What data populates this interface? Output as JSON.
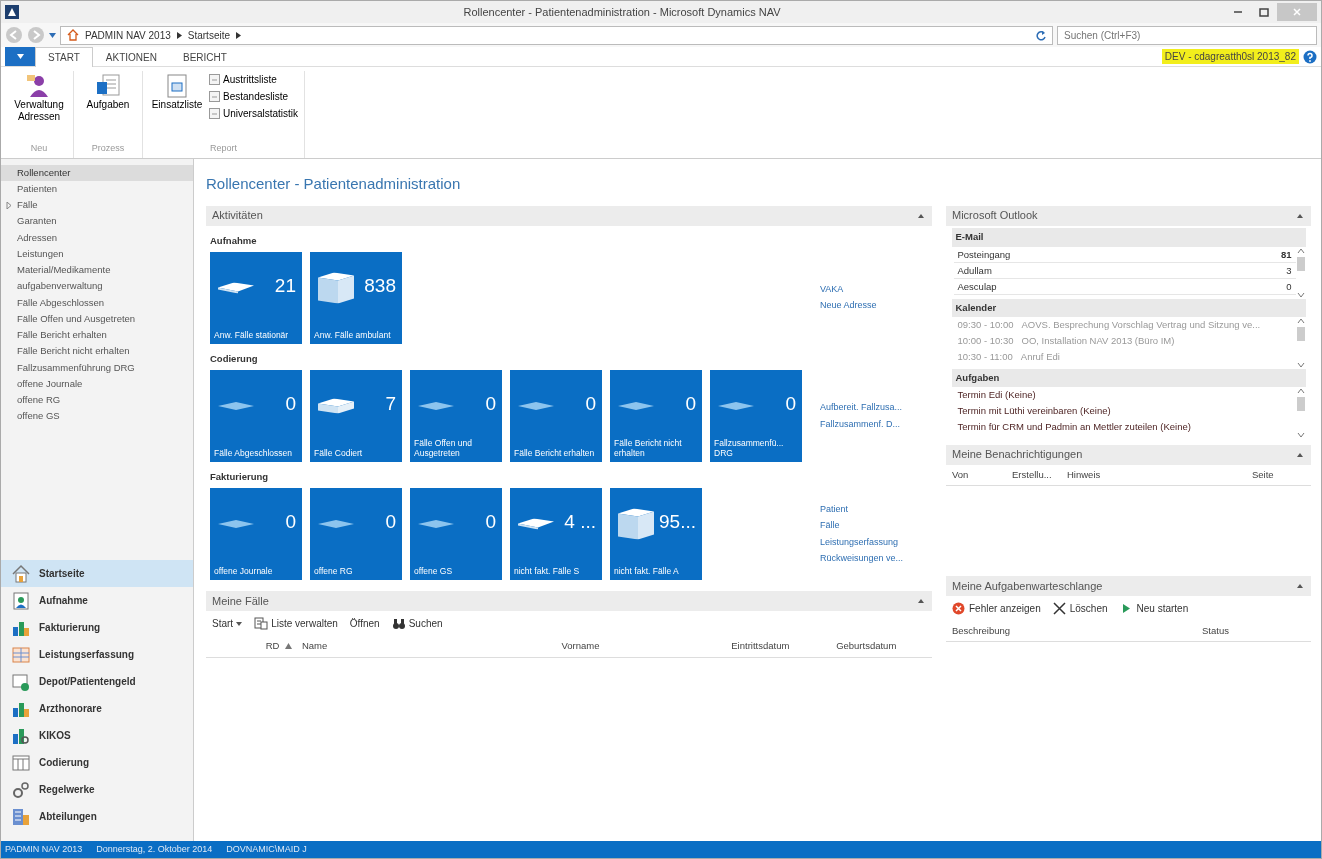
{
  "window": {
    "title": "Rollencenter - Patientenadministration - Microsoft Dynamics NAV"
  },
  "address_bar": {
    "breadcrumb": [
      "PADMIN NAV 2013",
      "Startseite"
    ],
    "search": {
      "placeholder": "Suchen (Ctrl+F3)"
    }
  },
  "ribbon": {
    "tabs": [
      {
        "label": "START",
        "selected": true
      },
      {
        "label": "AKTIONEN",
        "selected": false
      },
      {
        "label": "BERICHT",
        "selected": false
      }
    ],
    "company": "DEV - cdagreatth0sl 2013_82",
    "groups": [
      {
        "label": "Neu",
        "large": [
          {
            "label": "Verwaltung Adressen",
            "kind": "people"
          }
        ]
      },
      {
        "label": "Prozess",
        "large": [
          {
            "label": "Aufgaben",
            "kind": "tasks"
          }
        ]
      },
      {
        "label": "Report",
        "large": [
          {
            "label": "Einsatzliste",
            "kind": "report"
          }
        ],
        "small": [
          "Austrittsliste",
          "Bestandesliste",
          "Universalstatistik"
        ]
      }
    ]
  },
  "navigation": {
    "items": [
      {
        "label": "Rollencenter",
        "selected": true
      },
      {
        "label": "Patienten",
        "selected": false
      },
      {
        "label": "Fälle",
        "selected": false,
        "expanded": false
      },
      {
        "label": "Garanten",
        "selected": false
      },
      {
        "label": "Adressen",
        "selected": false
      },
      {
        "label": "Leistungen",
        "selected": false
      },
      {
        "label": "Material/Medikamente",
        "selected": false
      },
      {
        "label": "aufgabenverwaltung",
        "selected": false
      },
      {
        "label": "Fälle Abgeschlossen",
        "selected": false
      },
      {
        "label": "Fälle Offen und Ausgetreten",
        "selected": false
      },
      {
        "label": "Fälle Bericht erhalten",
        "selected": false
      },
      {
        "label": "Fälle Bericht nicht erhalten",
        "selected": false
      },
      {
        "label": "Fallzusammenführung DRG",
        "selected": false
      },
      {
        "label": "offene Journale",
        "selected": false
      },
      {
        "label": "offene RG",
        "selected": false
      },
      {
        "label": "offene GS",
        "selected": false
      }
    ],
    "departments": [
      {
        "label": "Startseite",
        "kind": "home",
        "selected": true
      },
      {
        "label": "Aufnahme",
        "kind": "intake",
        "selected": false
      },
      {
        "label": "Fakturierung",
        "kind": "chart",
        "selected": false
      },
      {
        "label": "Leistungserfassung",
        "kind": "table",
        "selected": false
      },
      {
        "label": "Depot/Patientengeld",
        "kind": "deposit",
        "selected": false
      },
      {
        "label": "Arzthonorare",
        "kind": "chart",
        "selected": false
      },
      {
        "label": "KIKOS",
        "kind": "chartsearch",
        "selected": false
      },
      {
        "label": "Codierung",
        "kind": "calendar",
        "selected": false
      },
      {
        "label": "Regelwerke",
        "kind": "gears",
        "selected": false
      },
      {
        "label": "Abteilungen",
        "kind": "building",
        "selected": false
      }
    ]
  },
  "page_title": "Rollencenter - Patientenadministration",
  "activities": {
    "title": "Aktivitäten",
    "groups": [
      {
        "label": "Aufnahme",
        "tiles": [
          {
            "value": "21",
            "caption": "Anw. Fälle stationär",
            "kind": "sheet"
          },
          {
            "value": "838",
            "caption": "Anw. Fälle ambulant",
            "kind": "stack"
          }
        ],
        "links": [
          "VAKA",
          "Neue Adresse"
        ]
      },
      {
        "label": "Codierung",
        "tiles": [
          {
            "value": "0",
            "caption": "Fälle Abgeschlossen",
            "kind": "empty"
          },
          {
            "value": "7",
            "caption": "Fälle Codiert",
            "kind": "pile"
          },
          {
            "value": "0",
            "caption": "Fälle Offen und Ausgetreten",
            "kind": "empty"
          },
          {
            "value": "0",
            "caption": "Fälle Bericht erhalten",
            "kind": "empty"
          },
          {
            "value": "0",
            "caption": "Fälle Bericht nicht erhalten",
            "kind": "empty"
          },
          {
            "value": "0",
            "caption": "Fallzusammenfü... DRG",
            "kind": "empty"
          }
        ],
        "links": [
          "Aufbereit. Fallzusa...",
          "Fallzusammenf. D..."
        ]
      },
      {
        "label": "Fakturierung",
        "tiles": [
          {
            "value": "0",
            "caption": "offene Journale",
            "kind": "empty"
          },
          {
            "value": "0",
            "caption": "offene RG",
            "kind": "empty"
          },
          {
            "value": "0",
            "caption": "offene GS",
            "kind": "empty"
          },
          {
            "value": "4 ...",
            "caption": "nicht fakt. Fälle S",
            "kind": "sheet"
          },
          {
            "value": "95...",
            "caption": "nicht fakt. Fälle A",
            "kind": "stack"
          }
        ],
        "links": [
          "Patient",
          "Fälle",
          "Leistungserfassung",
          "Rückweisungen ve..."
        ]
      }
    ]
  },
  "my_cases": {
    "title": "Meine Fälle",
    "actions": [
      {
        "label": "Start",
        "kind": "menu"
      },
      {
        "label": "Liste verwalten",
        "kind": "list"
      },
      {
        "label": "Öffnen",
        "kind": "plain"
      },
      {
        "label": "Suchen",
        "kind": "search"
      }
    ],
    "columns": [
      {
        "label": "RD",
        "sorted": true
      },
      {
        "label": "Name",
        "sorted": false
      },
      {
        "label": "Vorname",
        "sorted": false
      },
      {
        "label": "Eintrittsdatum",
        "sorted": false
      },
      {
        "label": "Geburtsdatum",
        "sorted": false
      }
    ]
  },
  "outlook": {
    "title": "Microsoft Outlook",
    "mail": {
      "label": "E-Mail",
      "folders": [
        {
          "name": "Posteingang",
          "count": "81",
          "unread": true
        },
        {
          "name": "Adullam",
          "count": "3",
          "unread": false
        },
        {
          "name": "Aesculap",
          "count": "0",
          "unread": false
        }
      ]
    },
    "calendar": {
      "label": "Kalender",
      "entries": [
        {
          "time": "09:30 - 10:00",
          "subject": "AOVS. Besprechung Vorschlag Vertrag und Sitzung ve..."
        },
        {
          "time": "10:00 - 10:30",
          "subject": "OO, Installation NAV 2013 (Büro IM)"
        },
        {
          "time": "10:30 - 11:00",
          "subject": "Anruf Edi"
        }
      ]
    },
    "tasks": {
      "label": "Aufgaben",
      "items": [
        "Termin Edi (Keine)",
        "Termin mit Lüthi vereinbaren (Keine)",
        "Termin für CRM und Padmin an Mettler zuteilen (Keine)"
      ]
    }
  },
  "notifications": {
    "title": "Meine Benachrichtigungen",
    "columns": [
      "Von",
      "Erstellu...",
      "Hinweis",
      "Seite"
    ]
  },
  "job_queue": {
    "title": "Meine Aufgabenwarteschlange",
    "actions": [
      {
        "label": "Fehler anzeigen",
        "kind": "error"
      },
      {
        "label": "Löschen",
        "kind": "delete"
      },
      {
        "label": "Neu starten",
        "kind": "play"
      }
    ],
    "columns": [
      "Beschreibung",
      "Status"
    ]
  },
  "status_bar": [
    "PADMIN NAV 2013",
    "Donnerstag, 2. Oktober 2014",
    "DOVNAMIC\\MAID J"
  ]
}
